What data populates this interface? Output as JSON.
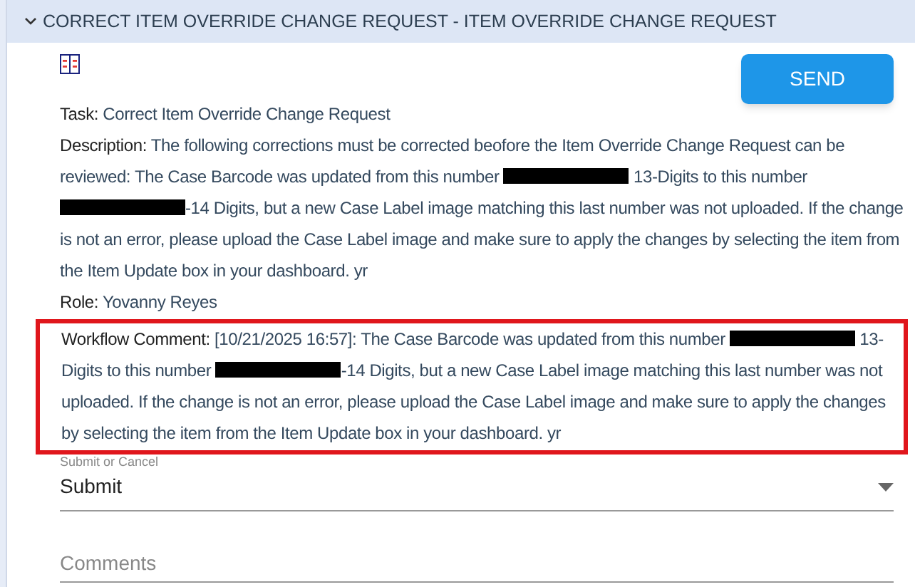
{
  "panel": {
    "title": "CORRECT ITEM OVERRIDE CHANGE REQUEST - ITEM OVERRIDE CHANGE REQUEST",
    "expanded": true
  },
  "send_button": "SEND",
  "details": [
    {
      "label": "Task:",
      "parts": [
        {
          "kind": "text",
          "text": "Correct Item Override Change Request"
        }
      ]
    },
    {
      "label": "Description:",
      "parts": [
        {
          "kind": "text",
          "text": "The following corrections must be corrected beofore the Item Override Change Request can be reviewed: The Case Barcode was updated from this number "
        },
        {
          "kind": "redacted"
        },
        {
          "kind": "text",
          "text": " 13-Digits to this number "
        },
        {
          "kind": "redacted"
        },
        {
          "kind": "text",
          "text": "-14 Digits, but a new Case Label image matching this last number was not uploaded. If the change is not an error, please upload the Case Label image and make sure to apply the changes by selecting the item from the Item Update box in your dashboard. yr"
        }
      ]
    },
    {
      "label": "Role:",
      "parts": [
        {
          "kind": "text",
          "text": "Yovanny Reyes"
        }
      ]
    }
  ],
  "workflow_comment": {
    "label": "Workflow Comment:",
    "highlighted": true,
    "parts": [
      {
        "kind": "text",
        "text": "[10/21/2025 16:57]: The Case Barcode was updated from this number "
      },
      {
        "kind": "redacted"
      },
      {
        "kind": "text",
        "text": " 13-Digits to this number "
      },
      {
        "kind": "redacted"
      },
      {
        "kind": "text",
        "text": "-14 Digits, but a new Case Label image matching this last number was not uploaded. If the change is not an error, please upload the Case Label image and make sure to apply the changes by selecting the item from the Item Update box in your dashboard. yr"
      }
    ]
  },
  "decision_field": {
    "label": "Submit or Cancel",
    "value": "Submit"
  },
  "comments_field": {
    "placeholder": "Comments"
  }
}
